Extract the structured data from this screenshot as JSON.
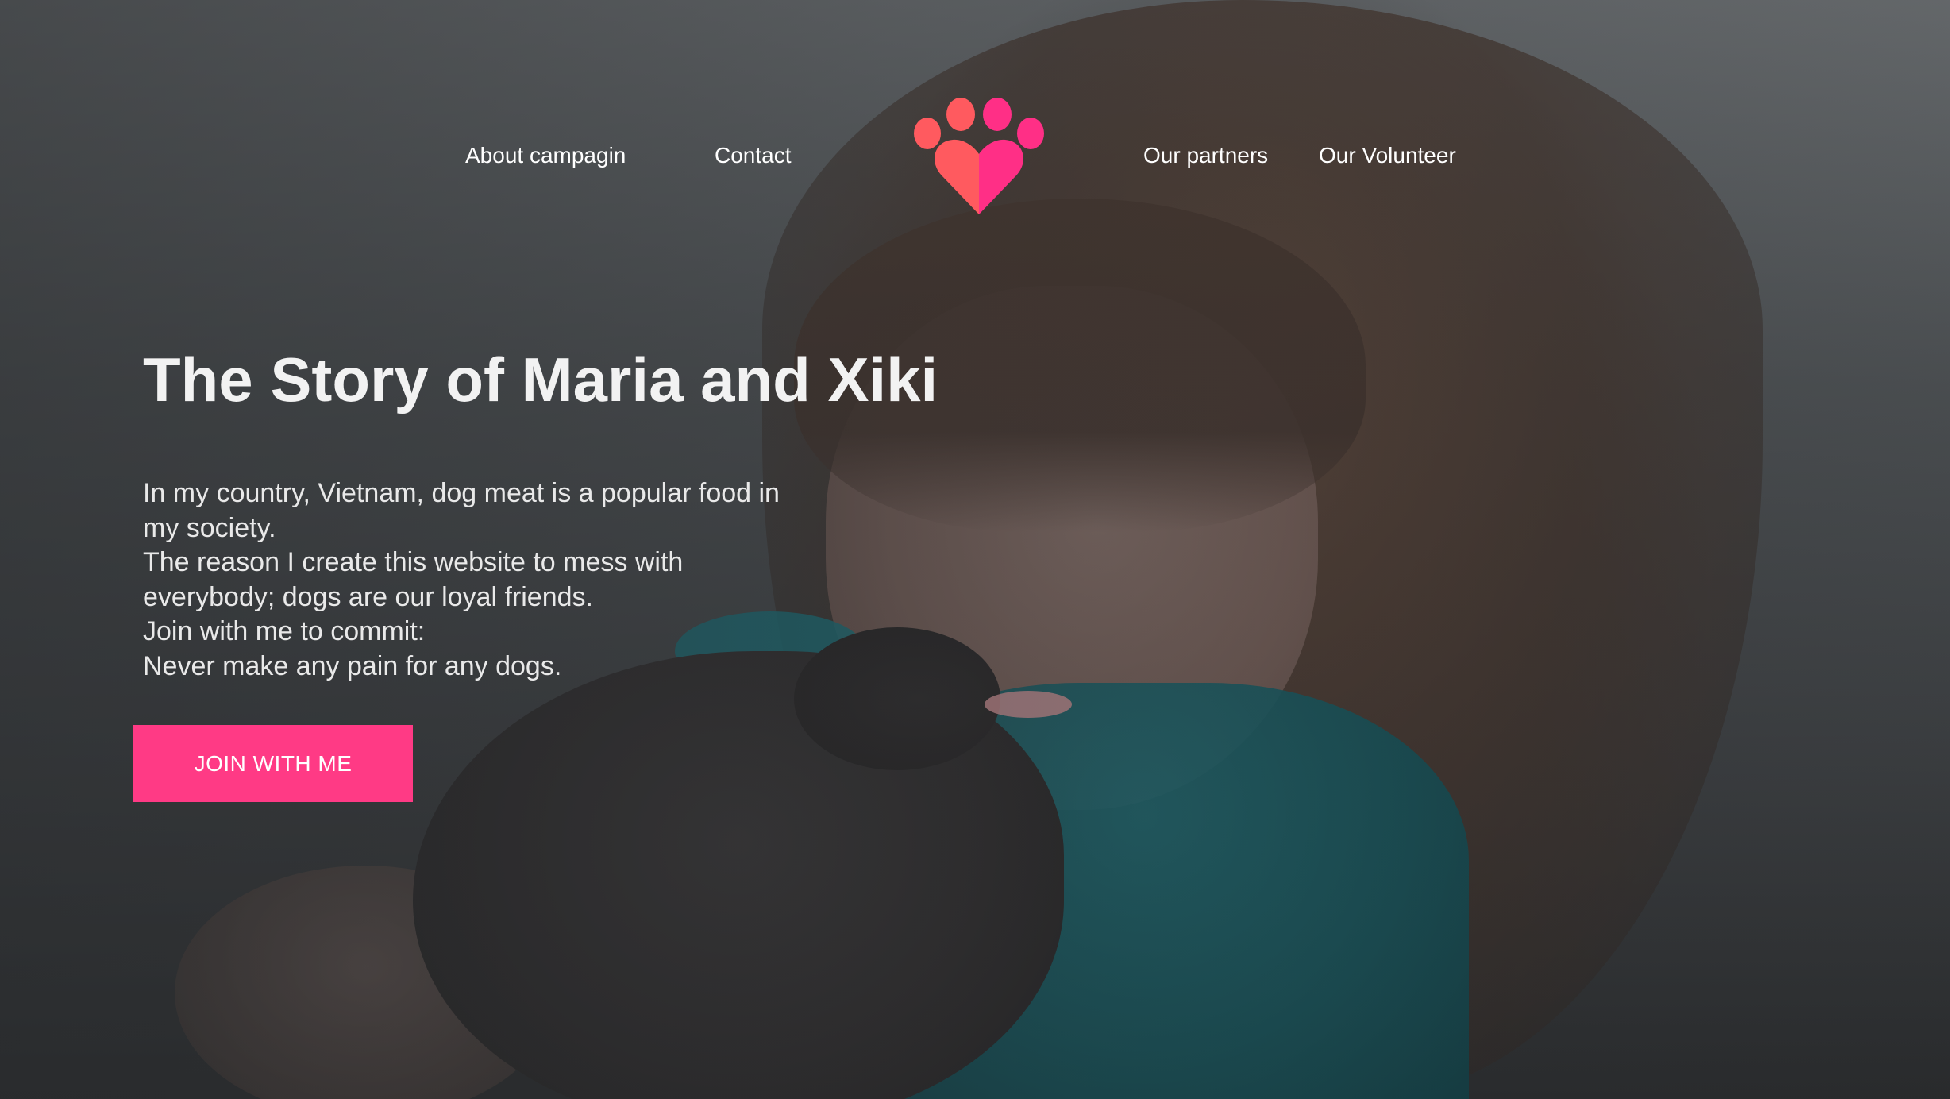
{
  "nav": {
    "left_links": [
      {
        "label": "About campagin"
      },
      {
        "label": "Contact"
      }
    ],
    "right_links": [
      {
        "label": "Our partners"
      },
      {
        "label": "Our Volunteer"
      }
    ],
    "logo_icon": "paw-heart-icon"
  },
  "hero": {
    "title": "The Story of Maria and Xiki",
    "body_lines": [
      "In my country, Vietnam, dog meat is a popular food in",
      "my society.",
      "The reason I create this website to mess with",
      "everybody; dogs are our loyal friends.",
      "Join with me to commit:",
      "Never make any pain for any dogs."
    ],
    "cta_label": "JOIN WITH ME"
  },
  "colors": {
    "accent": "#ff3a85",
    "logo_coral": "#ff5a5f",
    "logo_pink": "#ff2f86"
  }
}
